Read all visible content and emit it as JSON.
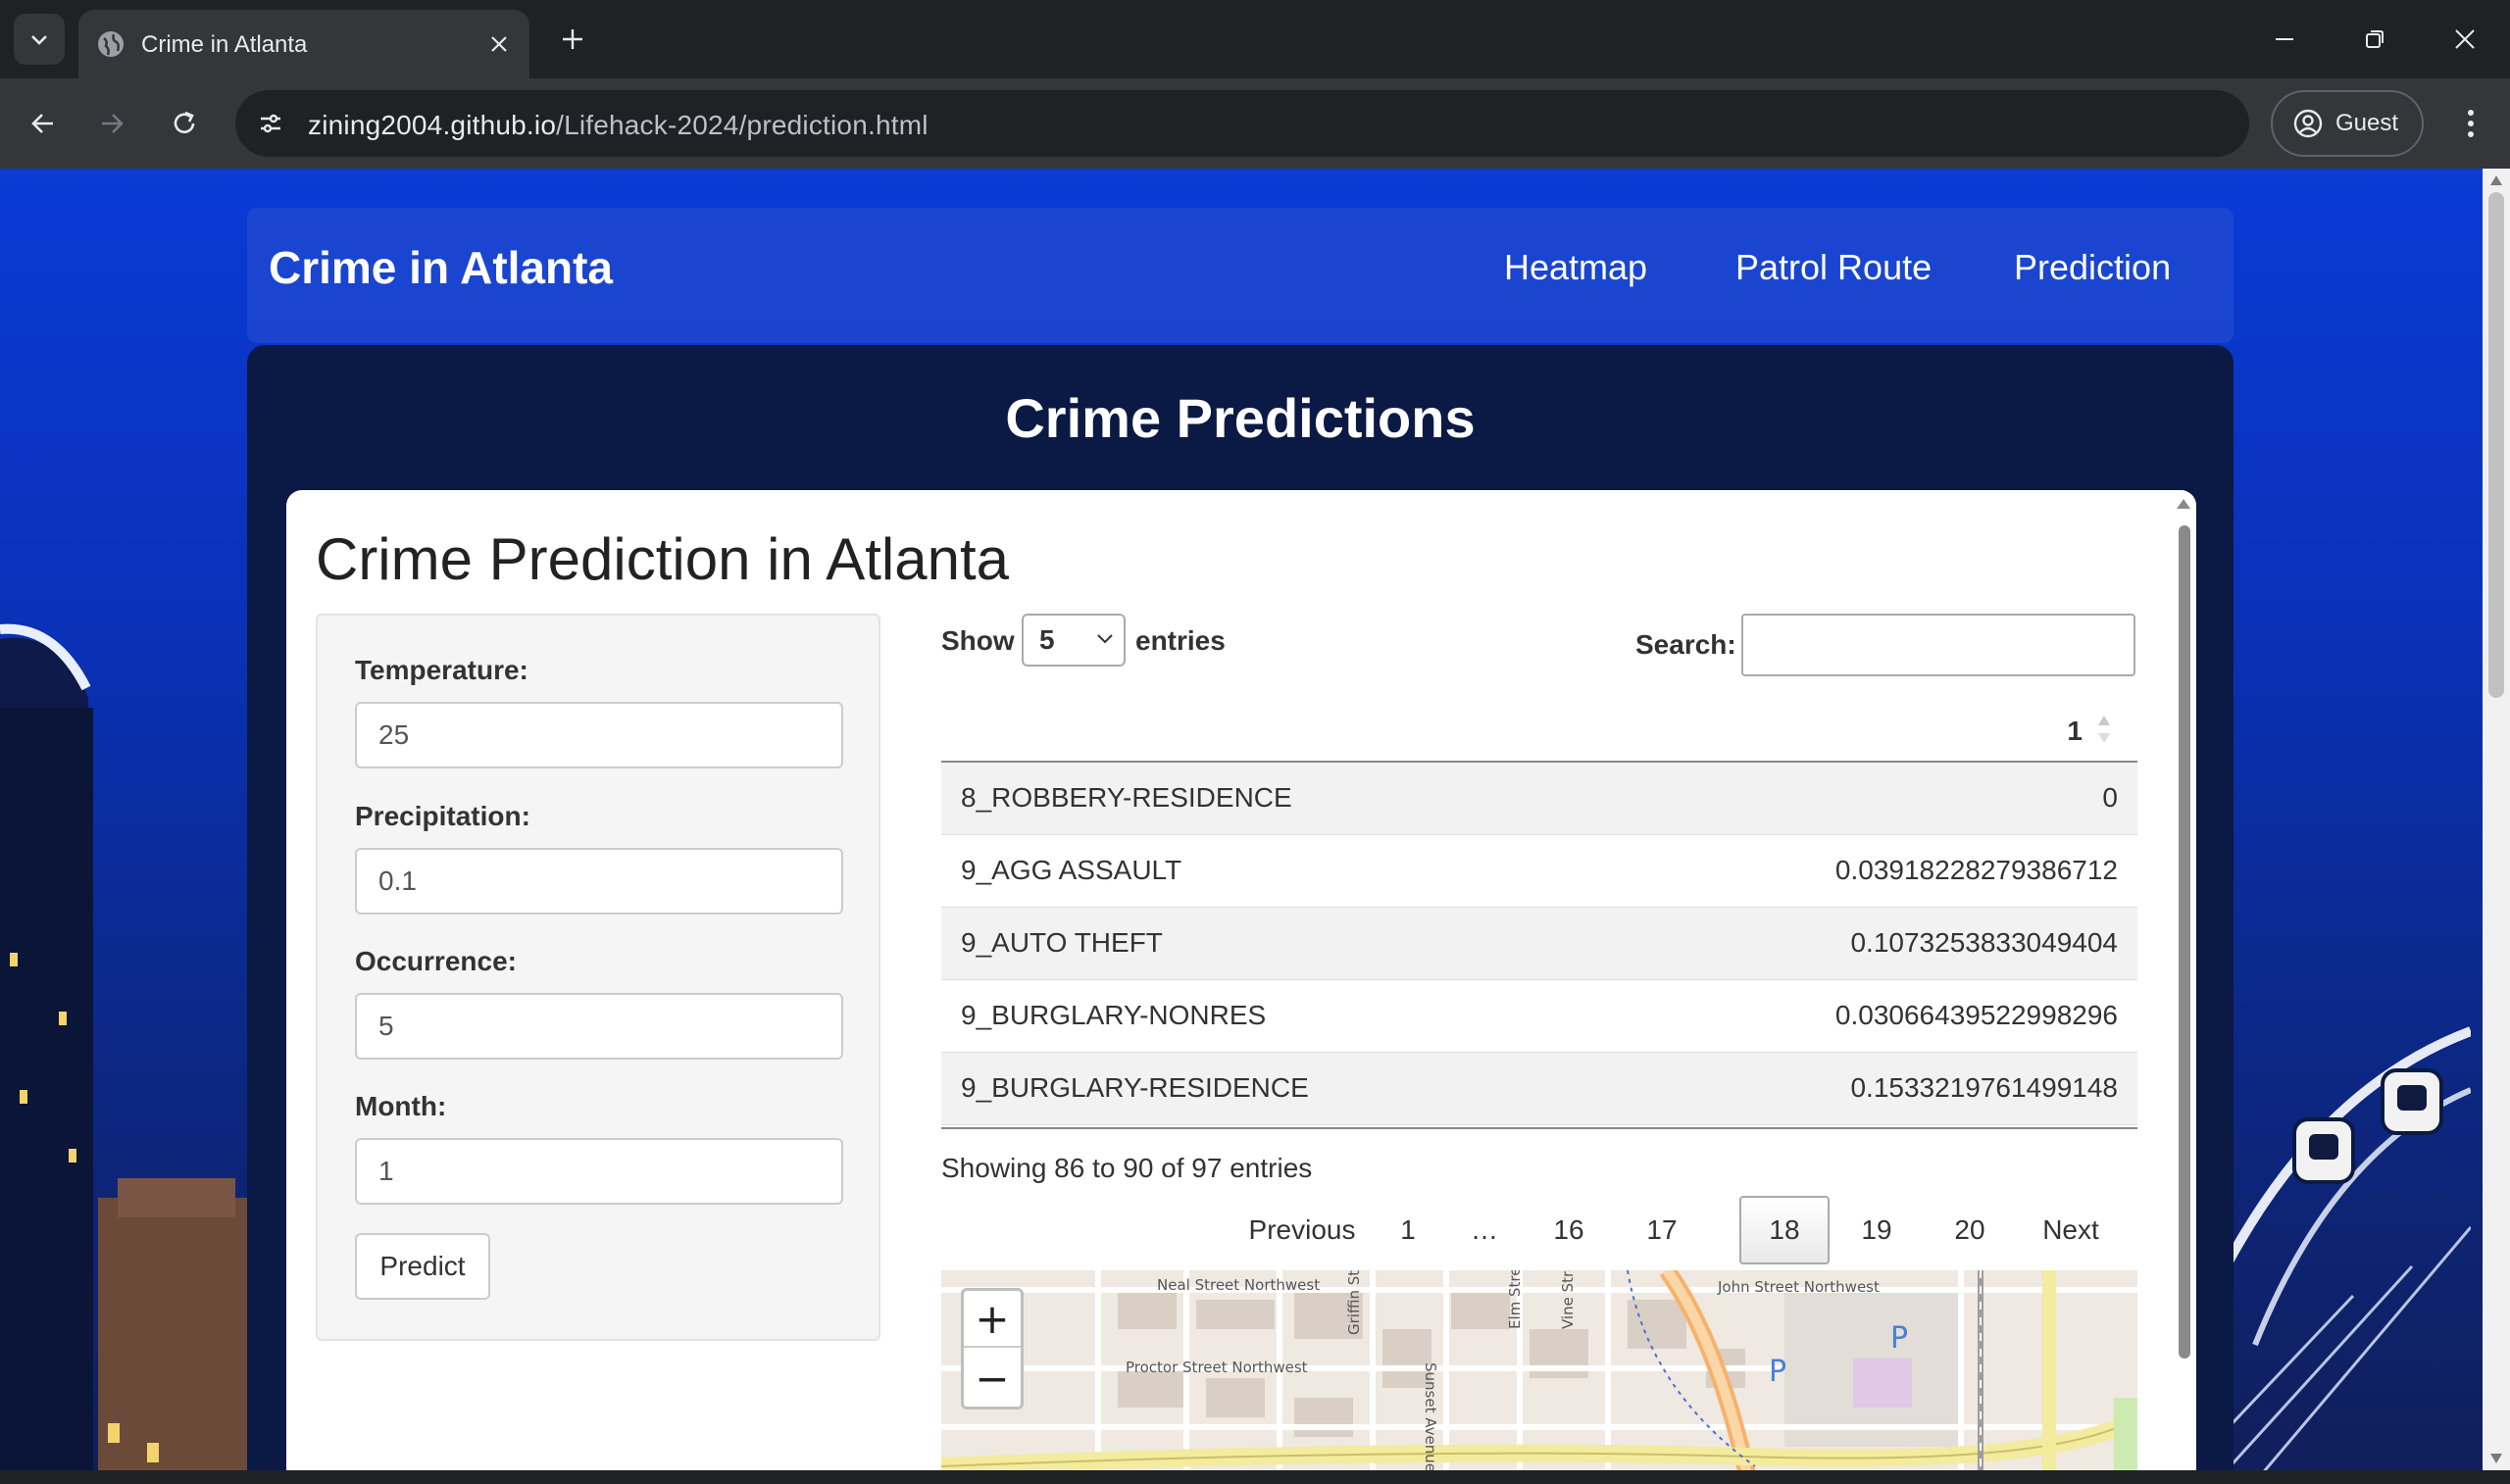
{
  "browser": {
    "tab_title": "Crime in Atlanta",
    "url_host": "zining2004.github.io",
    "url_path": "/Lifehack-2024/prediction.html",
    "profile_label": "Guest"
  },
  "navbar": {
    "brand": "Crime in Atlanta",
    "links": [
      "Heatmap",
      "Patrol Route",
      "Prediction"
    ]
  },
  "main": {
    "title": "Crime Predictions",
    "heading": "Crime Prediction in Atlanta"
  },
  "form": {
    "fields": [
      {
        "label": "Temperature:",
        "value": "25"
      },
      {
        "label": "Precipitation:",
        "value": "0.1"
      },
      {
        "label": "Occurrence:",
        "value": "5"
      },
      {
        "label": "Month:",
        "value": "1"
      }
    ],
    "submit_label": "Predict"
  },
  "table": {
    "show_label": "Show",
    "page_size": "5",
    "entries_label": "entries",
    "search_label": "Search:",
    "search_value": "",
    "column_header": "1",
    "rows": [
      {
        "name": "8_ROBBERY-RESIDENCE",
        "value": "0"
      },
      {
        "name": "9_AGG ASSAULT",
        "value": "0.03918228279386712"
      },
      {
        "name": "9_AUTO THEFT",
        "value": "0.1073253833049404"
      },
      {
        "name": "9_BURGLARY-NONRES",
        "value": "0.03066439522998296"
      },
      {
        "name": "9_BURGLARY-RESIDENCE",
        "value": "0.1533219761499148"
      }
    ],
    "info": "Showing 86 to 90 of 97 entries",
    "pagination": {
      "previous": "Previous",
      "pages": [
        "1",
        "…",
        "16",
        "17",
        "18",
        "19",
        "20"
      ],
      "current": "18",
      "next": "Next"
    }
  },
  "map": {
    "zoom_in": "+",
    "zoom_out": "−",
    "labels": [
      "Neal Street Northwest",
      "John Street Northwest",
      "Proctor Street Northwest",
      "Griffin Street Northwest",
      "Sunset Avenue",
      "Elm Street Northwest",
      "Vine Street North",
      "P",
      "P"
    ]
  }
}
